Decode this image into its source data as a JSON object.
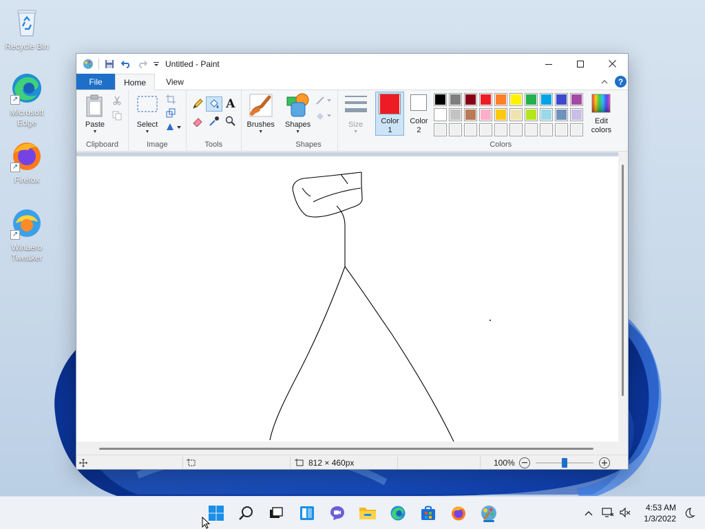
{
  "desktop": {
    "icons": [
      {
        "label": "Recycle Bin"
      },
      {
        "label": "Microsoft Edge"
      },
      {
        "label": "Firefox"
      },
      {
        "label": "Winaero Tweaker"
      }
    ]
  },
  "window": {
    "title": "Untitled - Paint",
    "tabs": {
      "file": "File",
      "home": "Home",
      "view": "View"
    },
    "ribbon": {
      "clipboard": {
        "label": "Clipboard",
        "paste": "Paste"
      },
      "image": {
        "label": "Image",
        "select": "Select"
      },
      "tools": {
        "label": "Tools"
      },
      "brushes": {
        "label": "Brushes"
      },
      "shapes": {
        "label": "Shapes",
        "shapes_btn": "Shapes"
      },
      "size": {
        "label": "Size"
      },
      "colors": {
        "label": "Colors",
        "color1": "Color 1",
        "color1_line1": "Color",
        "color1_line2": "1",
        "color2_line1": "Color",
        "color2_line2": "2",
        "edit_line1": "Edit",
        "edit_line2": "colors",
        "color1_value": "#ed1c24",
        "color2_value": "#ffffff",
        "palette_row1": [
          "#000000",
          "#7f7f7f",
          "#880015",
          "#ed1c24",
          "#ff7f27",
          "#fff200",
          "#22b14c",
          "#00a2e8",
          "#3f48cc",
          "#a349a4"
        ],
        "palette_row2": [
          "#ffffff",
          "#c3c3c3",
          "#b97a57",
          "#ffaec9",
          "#ffc90e",
          "#efe4b0",
          "#b5e61d",
          "#99d9ea",
          "#7092be",
          "#c8bfe7"
        ],
        "palette_row3": [
          "#f0f0f0",
          "#f0f0f0",
          "#f0f0f0",
          "#f0f0f0",
          "#f0f0f0",
          "#f0f0f0",
          "#f0f0f0",
          "#f0f0f0",
          "#f0f0f0",
          "#f0f0f0"
        ]
      }
    },
    "status": {
      "image_size": "812 × 460px",
      "zoom": "100%"
    }
  },
  "taskbar": {
    "time": "4:53 AM",
    "date": "1/3/2022"
  }
}
